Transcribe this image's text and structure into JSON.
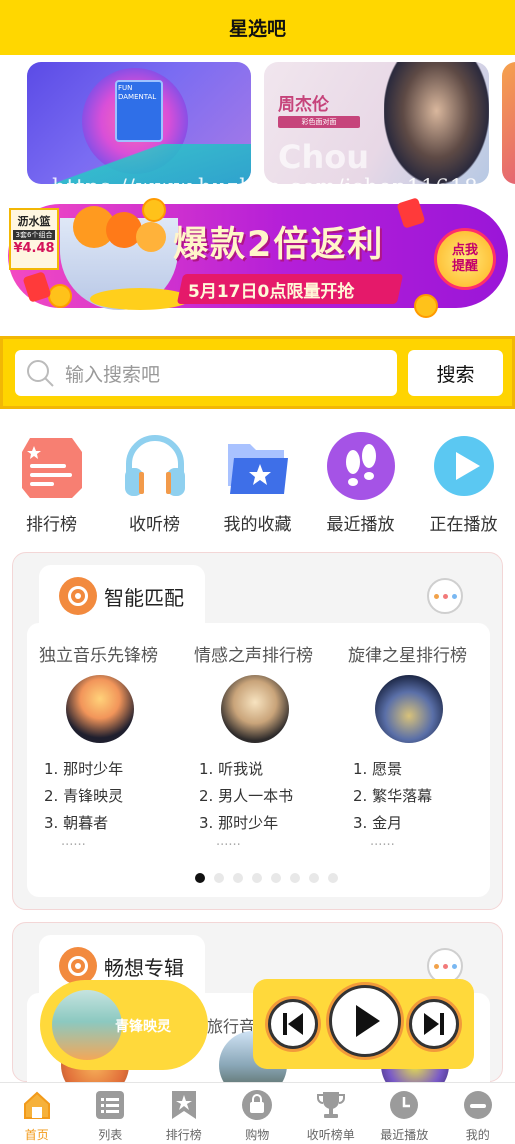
{
  "header": {
    "title": "星选吧"
  },
  "banner": {
    "slides": [
      {
        "album_text": "FUN DAMENTAL"
      },
      {
        "artist": "周杰伦",
        "tag": "彩色面对面",
        "ghost": "Chou"
      }
    ],
    "watermark": "https://www.huzhan.com/ishop11618",
    "active_dot": 0
  },
  "promo": {
    "price_line1": "沥水篮",
    "price_line2": "3套6个组合",
    "price_value": "¥4.48",
    "headline": "爆款2倍返利",
    "subline": "5月17日0点限量开抢",
    "remind_line1": "点我",
    "remind_line2": "提醒"
  },
  "search": {
    "placeholder": "输入搜索吧",
    "button": "搜索"
  },
  "quick_nav": [
    {
      "label": "排行榜",
      "icon": "ranking-icon"
    },
    {
      "label": "收听榜",
      "icon": "headphones-icon"
    },
    {
      "label": "我的收藏",
      "icon": "favorites-folder-icon"
    },
    {
      "label": "最近播放",
      "icon": "footprints-icon"
    },
    {
      "label": "正在播放",
      "icon": "play-circle-icon"
    }
  ],
  "smart_match": {
    "title": "智能匹配",
    "columns": [
      {
        "title": "独立音乐先锋榜",
        "items": [
          "1. 那时少年",
          "2. 青锋映灵",
          "3. 朝暮者"
        ],
        "ellipsis": "......"
      },
      {
        "title": "情感之声排行榜",
        "items": [
          "1. 听我说",
          "2. 男人一本书",
          "3. 那时少年"
        ],
        "ellipsis": "......"
      },
      {
        "title": "旋律之星排行榜",
        "items": [
          "1. 愿景",
          "2. 繁华落幕",
          "3. 金月"
        ],
        "ellipsis": "......"
      }
    ],
    "page_count": 8,
    "active_page": 0
  },
  "album_section": {
    "title": "畅想专辑",
    "visible_label": "旅行音乐"
  },
  "player": {
    "current_song": "青锋映灵"
  },
  "tabbar": [
    {
      "label": "首页",
      "icon": "home-icon",
      "active": true
    },
    {
      "label": "列表",
      "icon": "list-icon",
      "active": false
    },
    {
      "label": "排行榜",
      "icon": "bookmark-star-icon",
      "active": false
    },
    {
      "label": "购物",
      "icon": "shopping-bag-icon",
      "active": false
    },
    {
      "label": "收听榜单",
      "icon": "trophy-icon",
      "active": false
    },
    {
      "label": "最近播放",
      "icon": "clock-icon",
      "active": false
    },
    {
      "label": "我的",
      "icon": "profile-icon",
      "active": false
    }
  ],
  "colors": {
    "brand_yellow": "#ffd700",
    "accent_orange": "#f29a1a"
  }
}
